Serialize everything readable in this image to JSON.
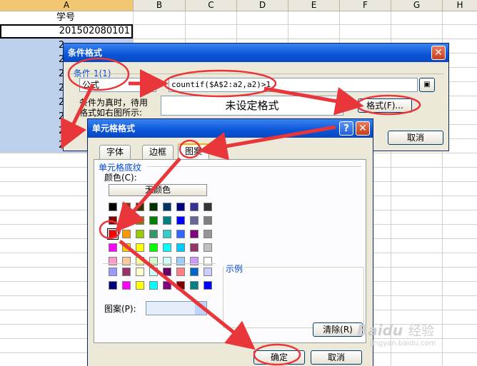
{
  "sheet": {
    "columns": [
      "A",
      "B",
      "C",
      "D",
      "E",
      "F",
      "G",
      "H"
    ],
    "a1": "学号",
    "a2": "201502080101",
    "row_fragments": [
      "2",
      "2",
      "2",
      "2",
      "2",
      "2",
      "2",
      "2"
    ],
    "last_fragment": "201502"
  },
  "cond_dialog": {
    "title": "条件格式",
    "condition_label": "条件 1(1)",
    "type_value": "公式",
    "formula": "countif($A$2:a2,a2)>1",
    "preview_caption_line1": "条件为真时，待用",
    "preview_caption_line2": "格式如右图所示:",
    "preview_text": "未设定格式",
    "format_button": "格式(F)...",
    "cancel_button": "取消"
  },
  "cell_dialog": {
    "title": "单元格格式",
    "tabs": [
      "字体",
      "边框",
      "图案"
    ],
    "active_tab_index": 2,
    "group_label": "单元格底纹",
    "color_label": "颜色(C):",
    "no_color_button": "无颜色",
    "sample_label": "示例",
    "pattern_label": "图案(P):",
    "clear_button": "清除(R)",
    "ok_button": "确定",
    "cancel_button": "取消",
    "palette_rows": [
      [
        "#000000",
        "#993300",
        "#333300",
        "#003300",
        "#003366",
        "#000080",
        "#333399",
        "#333333"
      ],
      [
        "#800000",
        "#FF6600",
        "#808000",
        "#008000",
        "#008080",
        "#0000FF",
        "#666699",
        "#808080"
      ],
      [
        "#FF0000",
        "#FF9900",
        "#99CC00",
        "#339966",
        "#33CCCC",
        "#3366FF",
        "#800080",
        "#969696"
      ],
      [
        "#FF00FF",
        "#FFCC00",
        "#FFFF00",
        "#00FF00",
        "#00FFFF",
        "#00CCFF",
        "#993366",
        "#C0C0C0"
      ],
      [
        "#FF99CC",
        "#FFCC99",
        "#FFFF99",
        "#CCFFCC",
        "#CCFFFF",
        "#99CCFF",
        "#CC99FF",
        "#FFFFFF"
      ]
    ],
    "extra_rows": [
      [
        "#9999FF",
        "#993366",
        "#FFFFCC",
        "#CCFFFF",
        "#660066",
        "#FF8080",
        "#0066CC",
        "#CCCCFF"
      ],
      [
        "#000080",
        "#FF00FF",
        "#FFFF00",
        "#00FFFF",
        "#800080",
        "#800000",
        "#008080",
        "#0000FF"
      ]
    ],
    "selected_color": "#FF0000"
  },
  "watermark": {
    "text_cn": "经验",
    "text_brand": "Baidu",
    "url": "jingyan.baidu.com"
  },
  "annotation_color": "#E8363B"
}
